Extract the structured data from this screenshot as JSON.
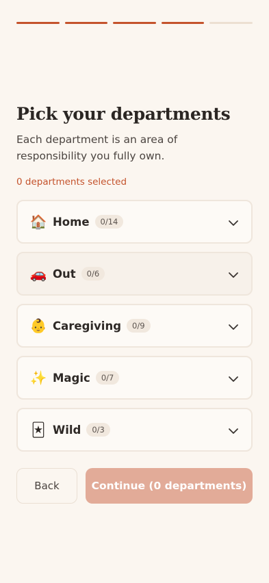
{
  "progress": {
    "total_steps": 5,
    "completed_steps": 4
  },
  "title": "Pick your departments",
  "subtitle": "Each department is an area of responsibility you fully own.",
  "selection_count": "0 departments selected",
  "departments": [
    {
      "emoji": "🏠",
      "icon": "house-icon",
      "name": "Home",
      "count": "0/14"
    },
    {
      "emoji": "🚗",
      "icon": "car-icon",
      "name": "Out",
      "count": "0/6"
    },
    {
      "emoji": "👶",
      "icon": "baby-icon",
      "name": "Caregiving",
      "count": "0/9"
    },
    {
      "emoji": "✨",
      "icon": "sparkles-icon",
      "name": "Magic",
      "count": "0/7"
    },
    {
      "emoji": "🃏",
      "icon": "joker-card-icon",
      "name": "Wild",
      "count": "0/3"
    }
  ],
  "buttons": {
    "back": "Back",
    "continue": "Continue (0 departments)"
  },
  "colors": {
    "accent": "#c4532c",
    "background": "#fbf6f0",
    "continue_disabled": "#e2ab98"
  }
}
